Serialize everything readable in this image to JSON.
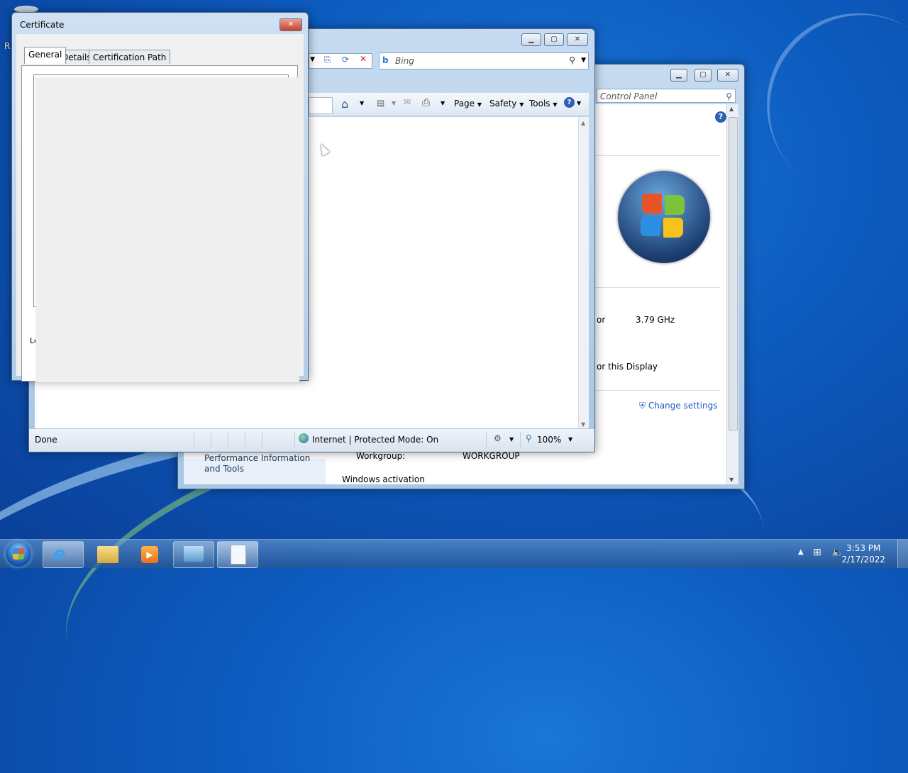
{
  "desktop": {
    "partial_label": "R"
  },
  "control_panel": {
    "search_placeholder": "Control Panel",
    "help_label": "?",
    "processor_partial": "or",
    "processor_speed": "3.79 GHz",
    "display_partial": "or this Display",
    "change_settings": "Change settings",
    "left_link": "Performance Information and Tools",
    "workgroup_label": "Workgroup:",
    "workgroup_value": "WORKGROUP",
    "activation_heading": "Windows activation"
  },
  "ie": {
    "search_engine": "Bing",
    "toolbar": {
      "page": "Page",
      "safety": "Safety",
      "tools": "Tools"
    },
    "status": {
      "done": "Done",
      "zone": "Internet | Protected Mode: On",
      "zoom": "100%"
    }
  },
  "certificate": {
    "title": "Certificate",
    "tabs": [
      "General",
      "Details",
      "Certification Path"
    ],
    "partial_label": "Le"
  },
  "taskbar": {
    "time": "3:53 PM",
    "date": "2/17/2022"
  }
}
